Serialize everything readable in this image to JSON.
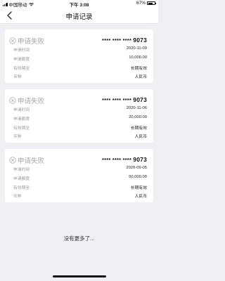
{
  "status_bar": {
    "carrier": "中国移动",
    "time": "下午 3:08",
    "battery": "67%",
    "battery_level": 0.67
  },
  "nav": {
    "title": "申请记录",
    "back_icon": "chevron-left-icon"
  },
  "labels": {
    "time": "申请时间",
    "amount": "申请额度",
    "validity": "有效期至",
    "currency": "币种"
  },
  "records": [
    {
      "status": "申请失败",
      "card_mask": "**** **** ****",
      "card_last4": "9073",
      "time": "2020-11-09",
      "amount": "10,000.00",
      "validity": "长期有效",
      "currency": "人民币"
    },
    {
      "status": "申请失败",
      "card_mask": "**** **** ****",
      "card_last4": "9073",
      "time": "2020-11-06",
      "amount": "20,000.00",
      "validity": "长期有效",
      "currency": "人民币"
    },
    {
      "status": "申请失败",
      "card_mask": "**** **** ****",
      "card_last4": "9073",
      "time": "2020-09-05",
      "amount": "50,000.00",
      "validity": "长期有效",
      "currency": "人民币"
    }
  ],
  "footer": "没有更多了..."
}
